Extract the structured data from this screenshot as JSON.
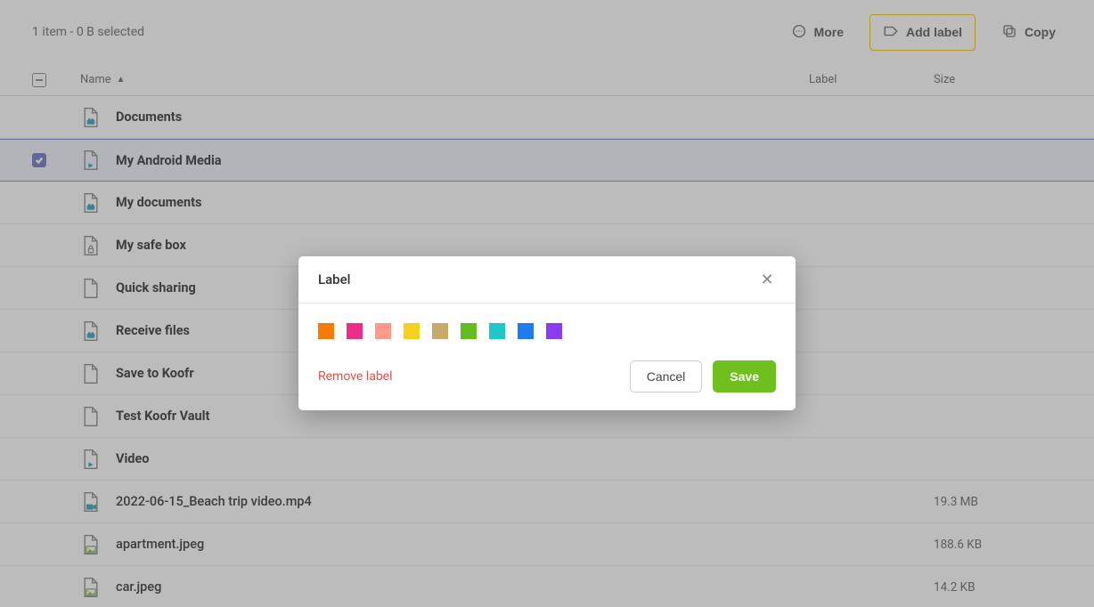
{
  "topbar": {
    "selection_text": "1 item - 0 B selected",
    "more_label": "More",
    "add_label_label": "Add label",
    "copy_label": "Copy"
  },
  "columns": {
    "name": "Name",
    "label": "Label",
    "size": "Size"
  },
  "rows": [
    {
      "name": "Documents",
      "type": "folder-shared",
      "selected": false,
      "size": ""
    },
    {
      "name": "My Android Media",
      "type": "folder-sync",
      "selected": true,
      "size": ""
    },
    {
      "name": "My documents",
      "type": "folder-shared",
      "selected": false,
      "size": ""
    },
    {
      "name": "My safe box",
      "type": "folder-lock",
      "selected": false,
      "size": ""
    },
    {
      "name": "Quick sharing",
      "type": "folder",
      "selected": false,
      "size": ""
    },
    {
      "name": "Receive files",
      "type": "folder-shared",
      "selected": false,
      "size": ""
    },
    {
      "name": "Save to Koofr",
      "type": "folder",
      "selected": false,
      "size": ""
    },
    {
      "name": "Test Koofr Vault",
      "type": "folder",
      "selected": false,
      "size": ""
    },
    {
      "name": "Video",
      "type": "folder-sync",
      "selected": false,
      "size": ""
    },
    {
      "name": "2022-06-15_Beach trip video.mp4",
      "type": "video",
      "selected": false,
      "size": "19.3 MB"
    },
    {
      "name": "apartment.jpeg",
      "type": "image",
      "selected": false,
      "size": "188.6 KB"
    },
    {
      "name": "car.jpeg",
      "type": "image",
      "selected": false,
      "size": "14.2 KB"
    }
  ],
  "modal": {
    "title": "Label",
    "remove_label": "Remove label",
    "cancel_label": "Cancel",
    "save_label": "Save",
    "colors": [
      "#f57c00",
      "#ec2e87",
      "#ff9a8b",
      "#f4d21f",
      "#c9a96a",
      "#66bb1f",
      "#1ec8c8",
      "#1e7bf0",
      "#8a3df0"
    ]
  }
}
